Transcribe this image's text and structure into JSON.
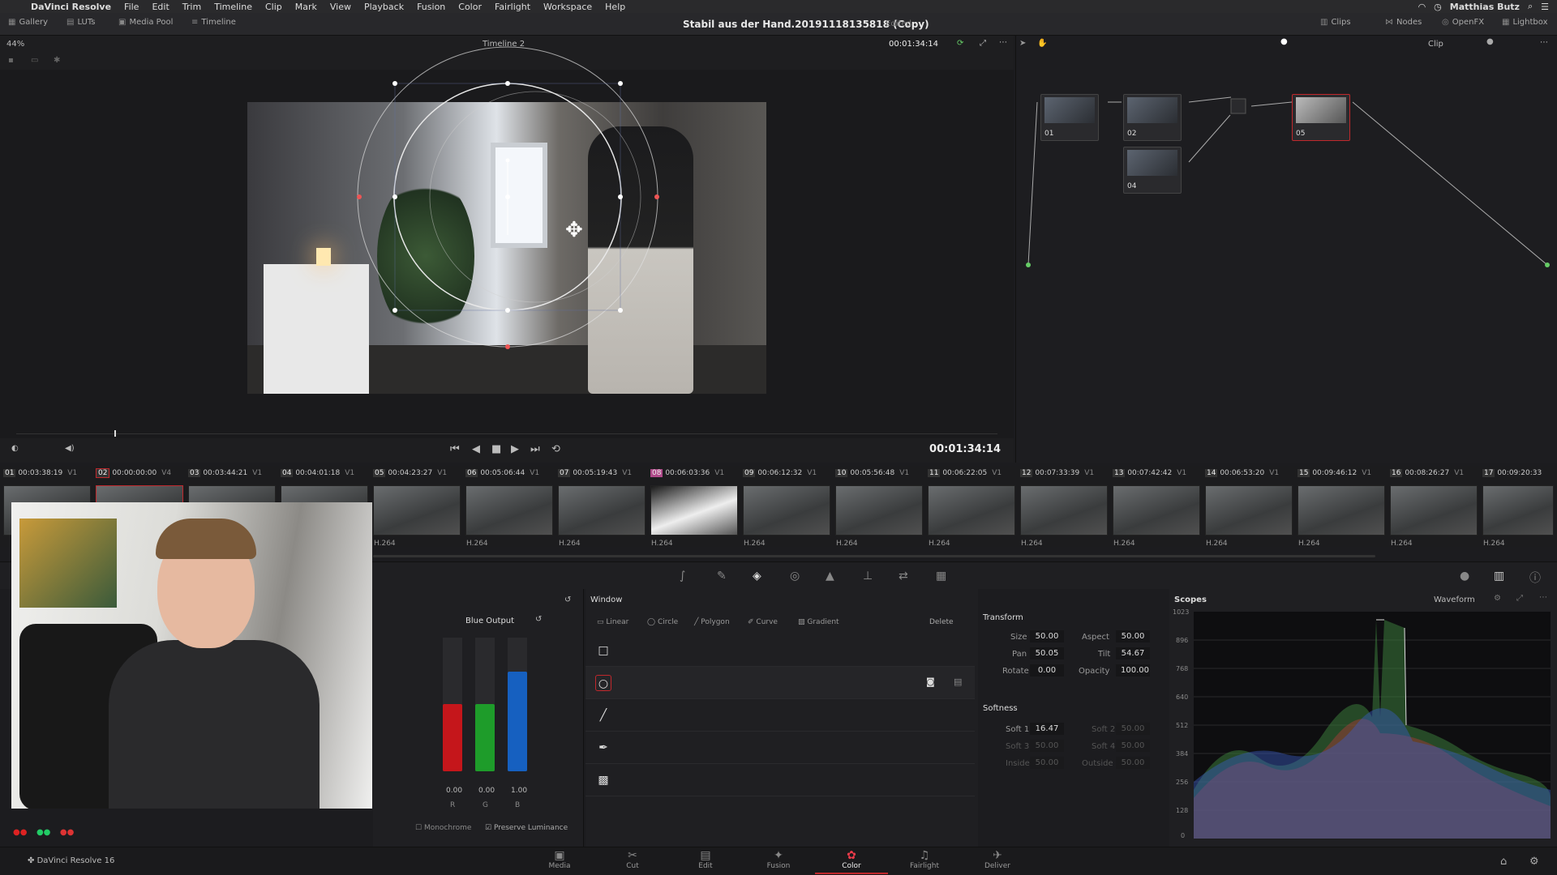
{
  "menubar": {
    "app": "DaVinci Resolve",
    "items": [
      "File",
      "Edit",
      "Trim",
      "Timeline",
      "Clip",
      "Mark",
      "View",
      "Playback",
      "Fusion",
      "Color",
      "Fairlight",
      "Workspace",
      "Help"
    ],
    "user": "Matthias Butz"
  },
  "toolbar": {
    "gallery": "Gallery",
    "luts": "LUTs",
    "media_pool": "Media Pool",
    "timeline": "Timeline",
    "project_title": "Stabil aus der Hand.20191118135818 (Copy)",
    "edited": "Edited",
    "clips": "Clips",
    "nodes": "Nodes",
    "openfx": "OpenFX",
    "lightbox": "Lightbox"
  },
  "viewer": {
    "zoom": "44%",
    "timeline_name": "Timeline 2",
    "timecode_top": "00:01:34:14",
    "clip_mode": "Clip",
    "timecode": "00:01:34:14"
  },
  "nodes": [
    {
      "label": "01"
    },
    {
      "label": "02"
    },
    {
      "label": "04"
    },
    {
      "label": "05"
    }
  ],
  "clips": [
    {
      "num": "01",
      "tc": "00:03:38:19",
      "track": "V1"
    },
    {
      "num": "02",
      "tc": "00:00:00:00",
      "track": "V4"
    },
    {
      "num": "03",
      "tc": "00:03:44:21",
      "track": "V1"
    },
    {
      "num": "04",
      "tc": "00:04:01:18",
      "track": "V1"
    },
    {
      "num": "05",
      "tc": "00:04:23:27",
      "track": "V1"
    },
    {
      "num": "06",
      "tc": "00:05:06:44",
      "track": "V1"
    },
    {
      "num": "07",
      "tc": "00:05:19:43",
      "track": "V1"
    },
    {
      "num": "08",
      "tc": "00:06:03:36",
      "track": "V1"
    },
    {
      "num": "09",
      "tc": "00:06:12:32",
      "track": "V1"
    },
    {
      "num": "10",
      "tc": "00:05:56:48",
      "track": "V1"
    },
    {
      "num": "11",
      "tc": "00:06:22:05",
      "track": "V1"
    },
    {
      "num": "12",
      "tc": "00:07:33:39",
      "track": "V1"
    },
    {
      "num": "13",
      "tc": "00:07:42:42",
      "track": "V1"
    },
    {
      "num": "14",
      "tc": "00:06:53:20",
      "track": "V1"
    },
    {
      "num": "15",
      "tc": "00:09:46:12",
      "track": "V1"
    },
    {
      "num": "16",
      "tc": "00:08:26:27",
      "track": "V1"
    },
    {
      "num": "17",
      "tc": "00:09:20:33",
      "track": ""
    }
  ],
  "codec": "H.264",
  "color_panel": {
    "title": "Blue Output",
    "r_val": "0.00",
    "g_val": "0.00",
    "b_val": "1.00",
    "r": "R",
    "g": "G",
    "b": "B",
    "monochrome": "Monochrome",
    "preserve": "Preserve Luminance"
  },
  "window_panel": {
    "title": "Window",
    "linear": "Linear",
    "circle": "Circle",
    "polygon": "Polygon",
    "curve": "Curve",
    "gradient": "Gradient",
    "delete": "Delete",
    "transform": "Transform",
    "size_l": "Size",
    "size": "50.00",
    "aspect_l": "Aspect",
    "aspect": "50.00",
    "pan_l": "Pan",
    "pan": "50.05",
    "tilt_l": "Tilt",
    "tilt": "54.67",
    "rotate_l": "Rotate",
    "rotate": "0.00",
    "opacity_l": "Opacity",
    "opacity": "100.00",
    "softness": "Softness",
    "soft1_l": "Soft 1",
    "soft1": "16.47",
    "soft2_l": "Soft 2",
    "soft2": "50.00",
    "soft3_l": "Soft 3",
    "soft3": "50.00",
    "soft4_l": "Soft 4",
    "soft4": "50.00",
    "inside_l": "Inside",
    "inside": "50.00",
    "outside_l": "Outside",
    "outside": "50.00"
  },
  "scopes": {
    "title": "Scopes",
    "mode": "Waveform",
    "ticks": [
      "1023",
      "896",
      "768",
      "640",
      "512",
      "384",
      "256",
      "128",
      "0"
    ]
  },
  "pagenav": {
    "brand": "DaVinci Resolve 16",
    "pages": [
      "Media",
      "Cut",
      "Edit",
      "Fusion",
      "Color",
      "Fairlight",
      "Deliver"
    ]
  },
  "colors": {
    "accent": "#c0282c",
    "red": "#d11a1f",
    "green": "#1ea52a",
    "blue": "#1466c8"
  }
}
